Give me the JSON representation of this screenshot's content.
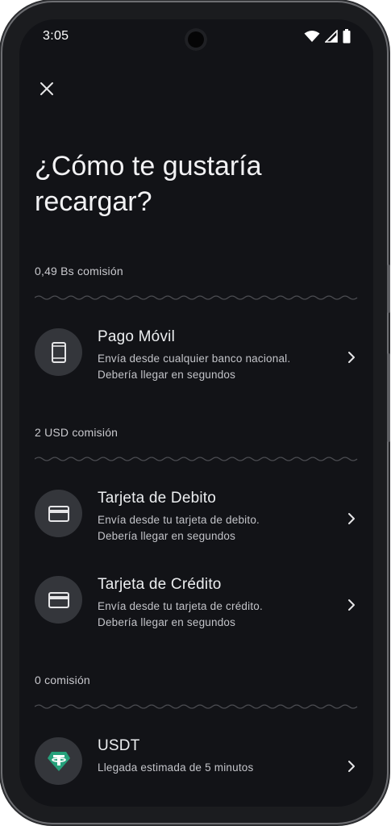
{
  "status_bar": {
    "time": "3:05"
  },
  "header": {
    "close_icon": "close-icon",
    "title": "¿Cómo te gustaría recargar?"
  },
  "sections": [
    {
      "label": "0,49 Bs comisión",
      "options": [
        {
          "icon": "smartphone-icon",
          "title": "Pago Móvil",
          "line1": "Envía desde cualquier banco nacional.",
          "line2": "Debería llegar en segundos"
        }
      ]
    },
    {
      "label": "2 USD comisión",
      "options": [
        {
          "icon": "credit-card-icon",
          "title": "Tarjeta de Debito",
          "line1": "Envía desde tu tarjeta de debito.",
          "line2": "Debería llegar en segundos"
        },
        {
          "icon": "credit-card-icon",
          "title": "Tarjeta de Crédito",
          "line1": "Envía desde tu tarjeta de crédito.",
          "line2": "Debería llegar en segundos"
        }
      ]
    },
    {
      "label": "0 comisión",
      "options": [
        {
          "icon": "tether-usdt-icon",
          "title": "USDT",
          "line1": "Llegada estimada de 5 minutos",
          "line2": ""
        }
      ]
    }
  ],
  "colors": {
    "background": "#121317",
    "icon_circle": "#34363b",
    "usdt_green": "#26a17b",
    "text_primary": "#eceef0",
    "text_secondary": "#c3c4c9"
  }
}
